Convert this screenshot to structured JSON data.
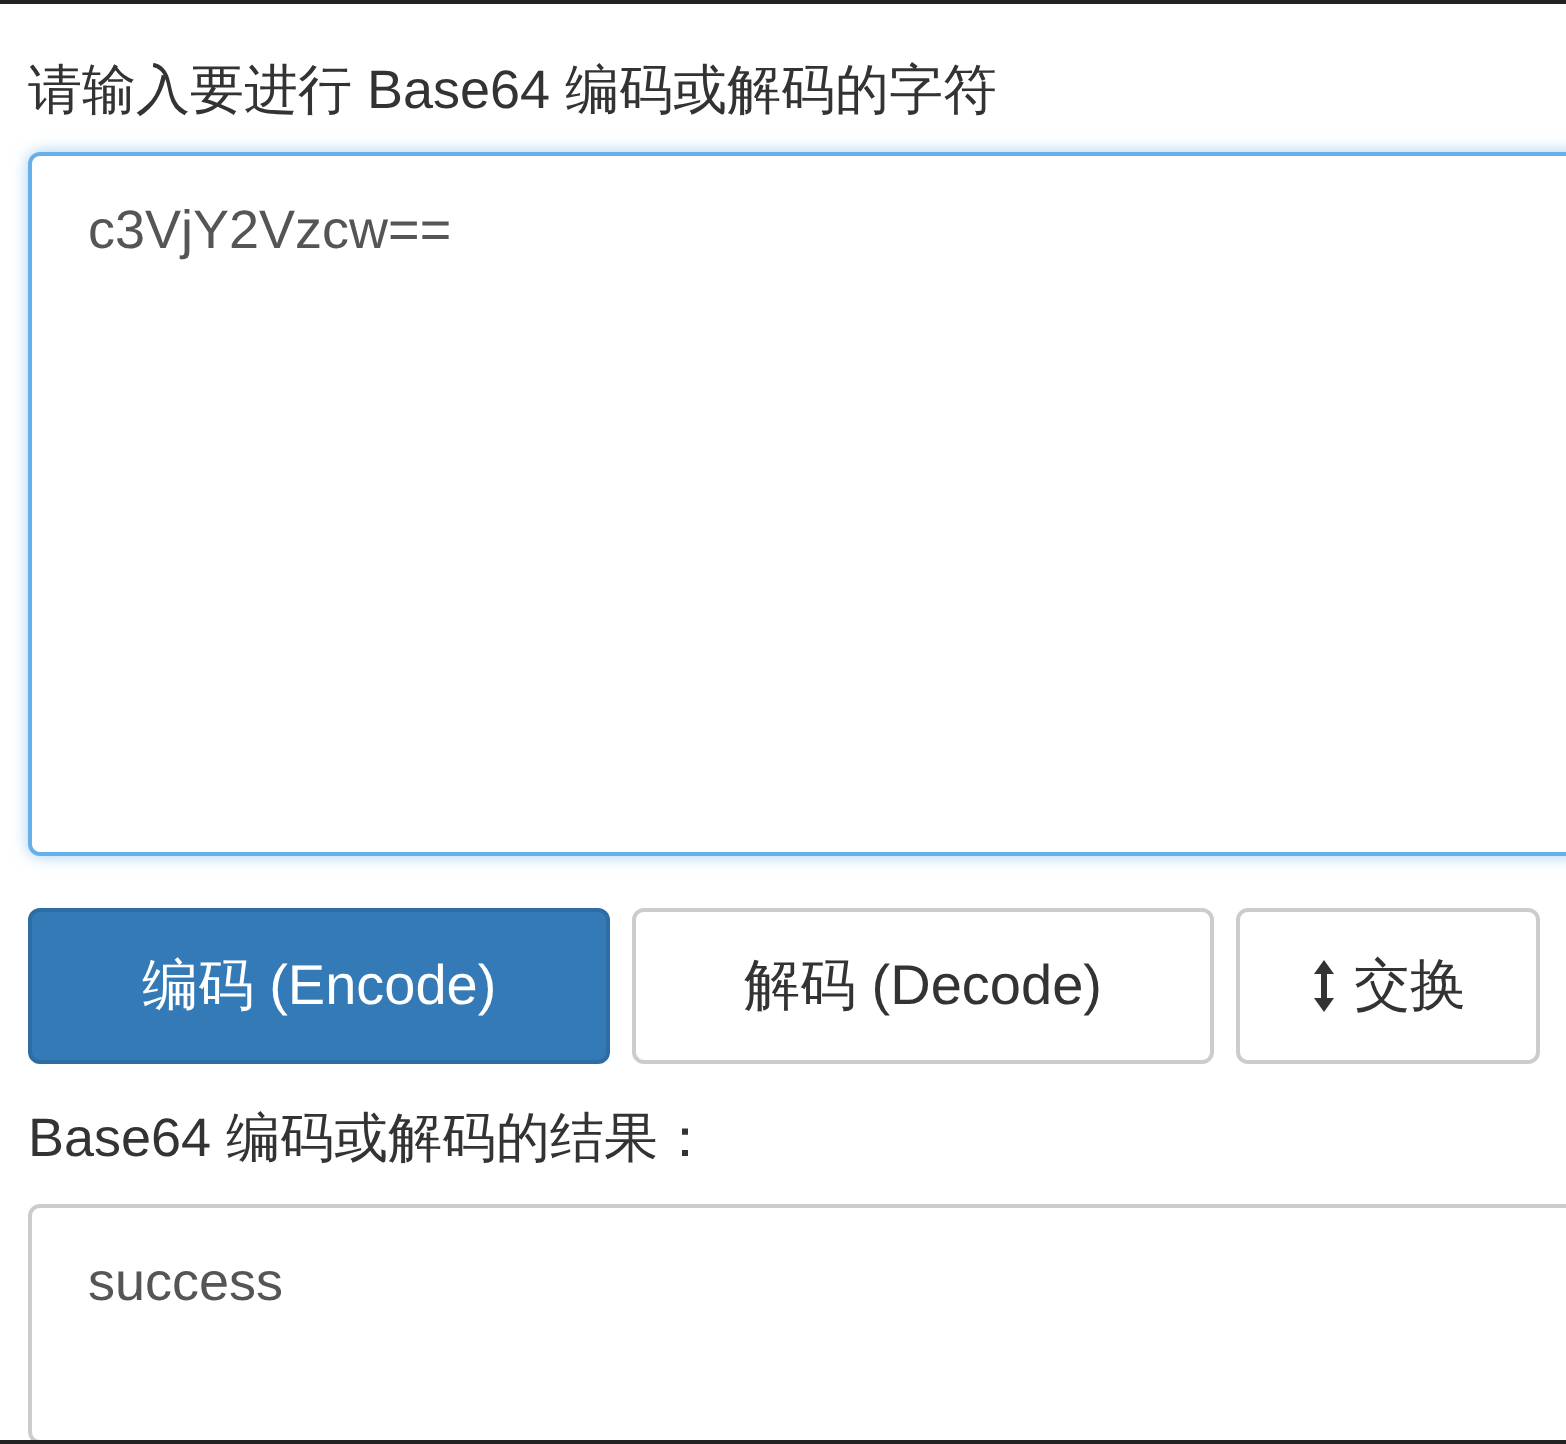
{
  "input_label": "请输入要进行 Base64 编码或解码的字符",
  "input": {
    "value": "c3VjY2Vzcw==",
    "focused": true
  },
  "buttons": [
    {
      "label": "编码 (Encode)",
      "kind": "primary"
    },
    {
      "label": "解码 (Decode)",
      "kind": "default"
    },
    {
      "label": "交换",
      "kind": "swap"
    }
  ],
  "result_label": "Base64 编码或解码的结果：",
  "result": {
    "value": "success"
  }
}
